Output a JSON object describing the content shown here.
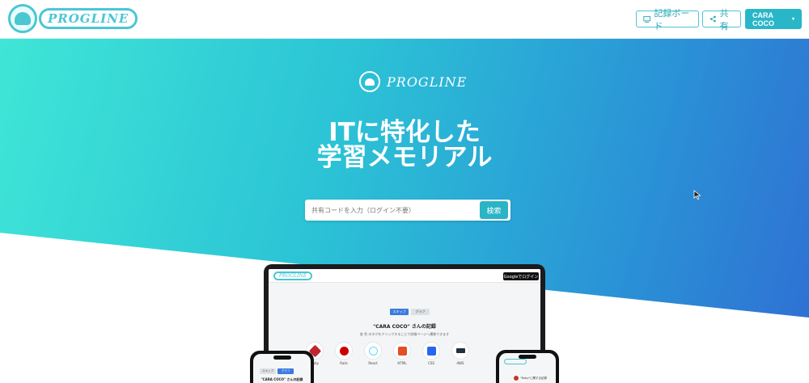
{
  "header": {
    "logo_text": "PROGLINE",
    "board_button": "記録ボード",
    "share_button": "共有",
    "user_button": "CARA COCO"
  },
  "hero": {
    "logo_text": "PROGLINE",
    "title_line1": "ITに特化した",
    "title_line2": "学習メモリアル",
    "search_placeholder": "共有コードを入力（ログイン不要）",
    "search_button": "検索"
  },
  "mockup": {
    "laptop": {
      "logo_text": "PROGLINE",
      "login_button": "Googleでログイン",
      "tabs": [
        "スキップ",
        "グラフ"
      ],
      "title": "\"CARA COCO\" さんの記録",
      "subtitle": "各 色 のタグをクリックすることで詳細ページへ遷移できます",
      "icons": [
        {
          "label": "Ruby",
          "color": "#c0262d"
        },
        {
          "label": "Rails",
          "color": "#cc0000"
        },
        {
          "label": "React",
          "color": "#61dafb"
        },
        {
          "label": "HTML",
          "color": "#e44d26"
        },
        {
          "label": "CSS",
          "color": "#2965f1"
        },
        {
          "label": "AWS",
          "color": "#232f3e"
        }
      ]
    },
    "phone_left": {
      "tabs": [
        "スキップ",
        "グラフ"
      ],
      "title": "\"CARA COCO\" さんの記録"
    },
    "phone_right": {
      "text": "\"Ruby\"に関する記録"
    }
  },
  "colors": {
    "accent": "#29b6c8",
    "gradient_start": "#3fe6d6",
    "gradient_end": "#2f6fd3"
  }
}
